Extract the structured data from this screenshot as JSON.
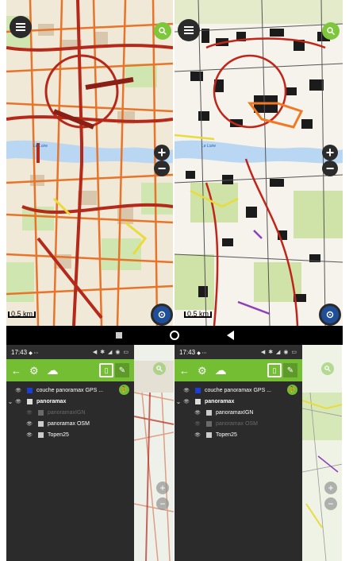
{
  "top_left_map": {
    "scale_label": "0.5 km",
    "river_label": "Le Loire",
    "buttons": {
      "menu_icon": "menu-icon",
      "search_icon": "search-icon",
      "zoom_in": "+",
      "zoom_out": "−",
      "locate_icon": "locate-icon"
    }
  },
  "top_right_map": {
    "scale_label": "0.5 km",
    "river_label": "Le Loire",
    "buttons": {
      "menu_icon": "menu-icon",
      "search_icon": "search-icon",
      "zoom_in": "+",
      "zoom_out": "−",
      "locate_icon": "locate-icon"
    }
  },
  "navbar": {
    "items": [
      "recents",
      "home",
      "back"
    ]
  },
  "left_phone": {
    "status": {
      "time": "17:43",
      "icons": "◆ ⋯",
      "right_icons": "◀ ✱ ◢ ◉ ▭"
    },
    "toolbar": {
      "back": "←",
      "settings": "⚙",
      "cloud": "☁",
      "map": "▯",
      "edit": "✎"
    },
    "layers": [
      {
        "label": "couche panoramax GPS ...",
        "eye": "👁",
        "dim": false,
        "bold": false,
        "color": "#1a3fd6",
        "indent": 1,
        "chevron": ""
      },
      {
        "label": "panoramax",
        "eye": "👁",
        "dim": false,
        "bold": true,
        "color": "#dddddd",
        "indent": 0,
        "chevron": "⌄"
      },
      {
        "label": "panoramaxIGN",
        "eye": "👁",
        "dim": true,
        "bold": false,
        "color": "#6a6a6a",
        "indent": 2,
        "chevron": ""
      },
      {
        "label": "panoramax OSM",
        "eye": "👁",
        "dim": false,
        "bold": false,
        "color": "#cccccc",
        "indent": 2,
        "chevron": ""
      },
      {
        "label": "Topen25",
        "eye": "👁",
        "dim": false,
        "bold": false,
        "color": "#cccccc",
        "indent": 2,
        "chevron": ""
      }
    ]
  },
  "right_phone": {
    "status": {
      "time": "17:43",
      "icons": "◆ ⋯",
      "right_icons": "◀ ✱ ◢ ◉ ▭"
    },
    "toolbar": {
      "back": "←",
      "settings": "⚙",
      "cloud": "☁",
      "map": "▯",
      "edit": "✎"
    },
    "layers": [
      {
        "label": "couche panoramax GPS ...",
        "eye": "👁",
        "dim": false,
        "bold": false,
        "color": "#1a3fd6",
        "indent": 1,
        "chevron": ""
      },
      {
        "label": "panoramax",
        "eye": "👁",
        "dim": false,
        "bold": true,
        "color": "#dddddd",
        "indent": 0,
        "chevron": "⌄"
      },
      {
        "label": "panoramaxIGN",
        "eye": "👁",
        "dim": false,
        "bold": false,
        "color": "#cccccc",
        "indent": 2,
        "chevron": ""
      },
      {
        "label": "panoramax OSM",
        "eye": "👁",
        "dim": true,
        "bold": false,
        "color": "#6a6a6a",
        "indent": 2,
        "chevron": ""
      },
      {
        "label": "Topen25",
        "eye": "👁",
        "dim": false,
        "bold": false,
        "color": "#cccccc",
        "indent": 2,
        "chevron": ""
      }
    ]
  },
  "colors": {
    "accent_green": "#74be34",
    "drawer_bg": "#2b2b2b",
    "river": "#b9d6f2",
    "road_red": "#b5291b"
  }
}
